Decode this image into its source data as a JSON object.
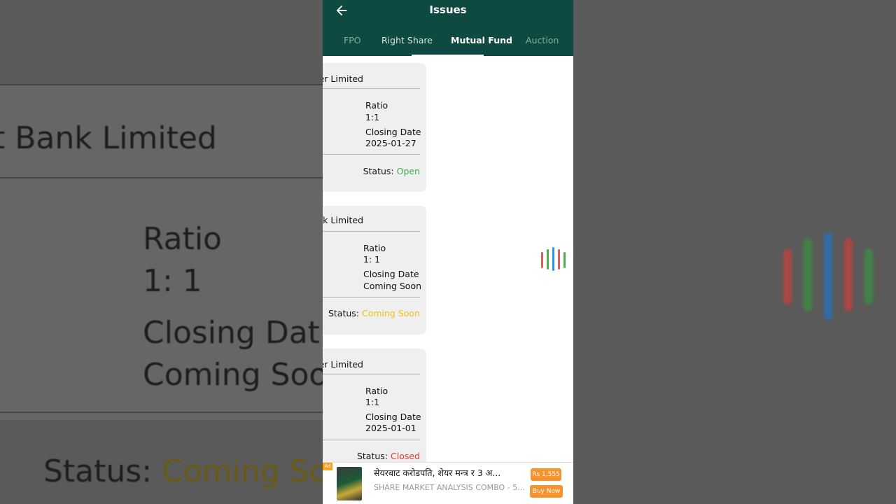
{
  "colors": {
    "header_bg": "#0e4a42",
    "status_open": "#3fae49",
    "status_coming_soon": "#f2c016",
    "status_closed": "#e23b2e",
    "ad_orange": "#f7932c",
    "loader": [
      "#e05a5a",
      "#4caf50",
      "#2196f3",
      "#e05a5a",
      "#4caf50"
    ]
  },
  "header": {
    "title": "Issues",
    "back_icon": "arrow-left-icon"
  },
  "tabs": [
    {
      "label": "FPO",
      "active": false
    },
    {
      "label": "Right Share",
      "active": false
    },
    {
      "label": "Mutual Fund",
      "active": true
    },
    {
      "label": "Auction",
      "active": false
    }
  ],
  "cards": [
    {
      "name": "er Limited",
      "ratio_label": "Ratio",
      "ratio": "1:1",
      "closing_label": "Closing Date",
      "closing": "2025-01-27",
      "status_label": "Status:",
      "status": "Open"
    },
    {
      "name": "t Bank Limited",
      "ratio_label": "Ratio",
      "ratio": "1: 1",
      "closing_label": "Closing Date",
      "closing": "Coming Soon",
      "status_label": "Status:",
      "status": "Coming Soon"
    },
    {
      "name": "er Limited",
      "ratio_label": "Ratio",
      "ratio": "1:1",
      "closing_label": "Closing Date",
      "closing": "2025-01-01",
      "status_label": "Status:",
      "status": "Closed"
    }
  ],
  "background_zoom": {
    "name": "t Bank Limited",
    "ratio_label": "Ratio",
    "ratio": "1: 1",
    "closing_label": "Closing Dat",
    "closing": "Coming Soo",
    "status_label": "Status:",
    "status": "Coming Soo"
  },
  "ad": {
    "badge": "Ad",
    "title": "सेयरबाट करोडपति, शेयर मन्त्र र 3 अ...",
    "subtitle": "SHARE MARKET ANALYSIS COMBO - 5...",
    "price": "Rs 1,555",
    "buy_label": "Buy Now"
  }
}
